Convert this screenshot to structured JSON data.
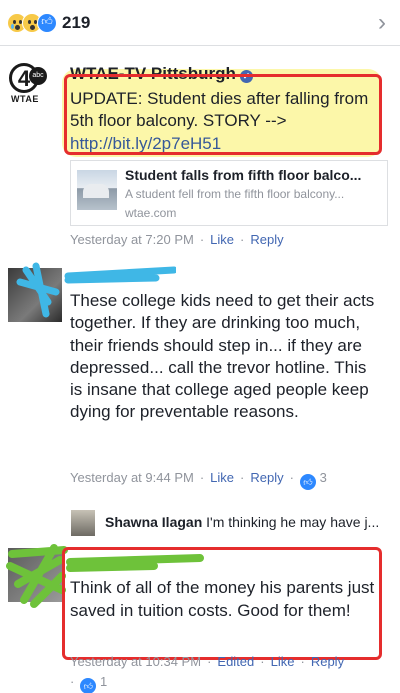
{
  "reactions_bar": {
    "count": "219",
    "icons": [
      "sad-icon",
      "wow-icon",
      "like-icon"
    ]
  },
  "post": {
    "page_name": "WTAE-TV Pittsburgh",
    "logo_text": "WTAE",
    "logo_badge": "abc",
    "logo_number": "4",
    "text": "UPDATE: Student dies after falling from 5th floor balcony. STORY -->",
    "link": "http://bit.ly/2p7eH51",
    "link_card": {
      "title": "Student falls from fifth floor balco...",
      "description": "A student fell from the fifth floor balcony...",
      "domain": "wtae.com"
    },
    "time": "Yesterday at 7:20 PM",
    "like_label": "Like",
    "reply_label": "Reply"
  },
  "comment1": {
    "text": "These college kids need to get their acts together.  If they are drinking too much, their friends should step in... if they are depressed... call the trevor hotline.  This is insane that college aged people keep dying for preventable reasons.",
    "time": "Yesterday at 9:44 PM",
    "like_label": "Like",
    "reply_label": "Reply",
    "reaction_count": "3"
  },
  "reply_preview": {
    "name": "Shawna Ilagan",
    "text": "I'm thinking he may have j..."
  },
  "comment2": {
    "text": "Think of all of the money his parents just saved in tuition costs. Good for them!",
    "time": "Yesterday at 10:34 PM",
    "edited_label": "Edited",
    "like_label": "Like",
    "reply_label": "Reply",
    "reaction_count": "1"
  },
  "colors": {
    "link": "#365899",
    "action": "#4267b2",
    "annotation_red": "#e52d2d",
    "highlight": "#fbf69a",
    "scribble_cyan": "#3fb7e6",
    "scribble_green": "#6ec23a"
  }
}
